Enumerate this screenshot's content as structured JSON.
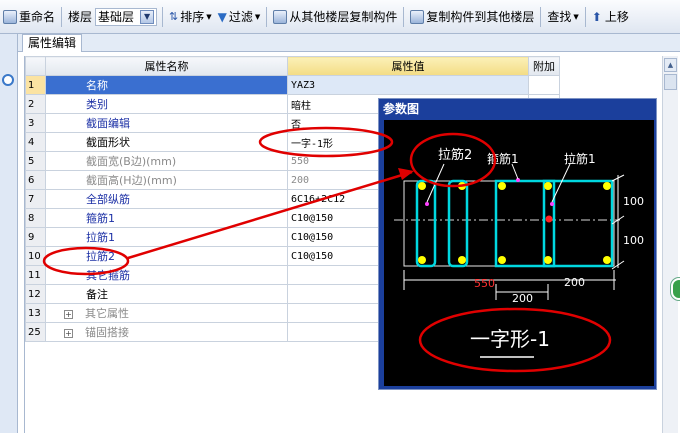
{
  "toolbar": {
    "rename": "重命名",
    "floor_label": "楼层",
    "floor_value": "基础层",
    "sort": "排序",
    "filter": "过滤",
    "copy_from": "从其他楼层复制构件",
    "copy_to": "复制构件到其他楼层",
    "find": "查找",
    "move_up": "上移"
  },
  "tab": {
    "label": "属性编辑"
  },
  "table": {
    "headers": {
      "name": "属性名称",
      "value": "属性值",
      "extra": "附加"
    },
    "rows": [
      {
        "num": "1",
        "name": "名称",
        "value": "YAZ3"
      },
      {
        "num": "2",
        "name": "类别",
        "value": "暗柱"
      },
      {
        "num": "3",
        "name": "截面编辑",
        "value": "否"
      },
      {
        "num": "4",
        "name": "截面形状",
        "value": "一字-1形"
      },
      {
        "num": "5",
        "name": "截面宽(B边)(mm)",
        "value": "550"
      },
      {
        "num": "6",
        "name": "截面高(H边)(mm)",
        "value": "200"
      },
      {
        "num": "7",
        "name": "全部纵筋",
        "value": "6C16+2C12"
      },
      {
        "num": "8",
        "name": "箍筋1",
        "value": "C10@150"
      },
      {
        "num": "9",
        "name": "拉筋1",
        "value": "C10@150"
      },
      {
        "num": "10",
        "name": "拉筋2",
        "value": "C10@150"
      },
      {
        "num": "11",
        "name": "其它箍筋",
        "value": ""
      },
      {
        "num": "12",
        "name": "备注",
        "value": ""
      },
      {
        "num": "13",
        "name": "其它属性",
        "value": ""
      },
      {
        "num": "25",
        "name": "锚固搭接",
        "value": ""
      }
    ]
  },
  "param_window": {
    "title": "参数图",
    "label_tie2": "拉筋2",
    "label_stirrup1": "箍筋1",
    "label_tie1": "拉筋1",
    "dim_right_top": "100",
    "dim_right_bottom": "100",
    "dim_width": "550",
    "dim_200_left": "200",
    "dim_200_right": "200",
    "shape_name": "一字形-1"
  }
}
